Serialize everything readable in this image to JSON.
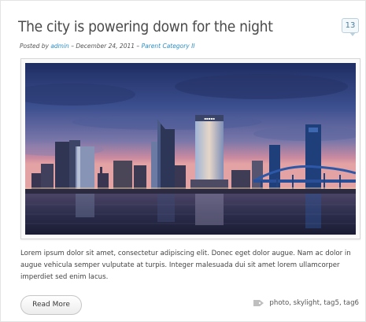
{
  "post": {
    "title": "The city is powering down for the night",
    "comment_count": "13",
    "meta": {
      "prefix": "Posted by",
      "author": "admin",
      "separator_1": "–",
      "date": "December 24, 2011",
      "separator_2": "–",
      "category": "Parent Category II"
    },
    "image_subject": "city-skyline-at-dusk",
    "excerpt": "Lorem ipsum dolor sit amet, consectetur adipiscing elit. Donec eget dolor augue. Nam ac dolor in augue vehicula semper vulputate at turpis. Integer malesuada dui sit amet lorem ullamcorper imperdiet sed enim lacus.",
    "read_more_label": "Read More",
    "tags_icon": "tag-icon",
    "tags": "photo, skylight, tag5, tag6"
  },
  "colors": {
    "link": "#2a8fc9",
    "title": "#4a4a4a",
    "badge_text": "#4d7fa0"
  }
}
